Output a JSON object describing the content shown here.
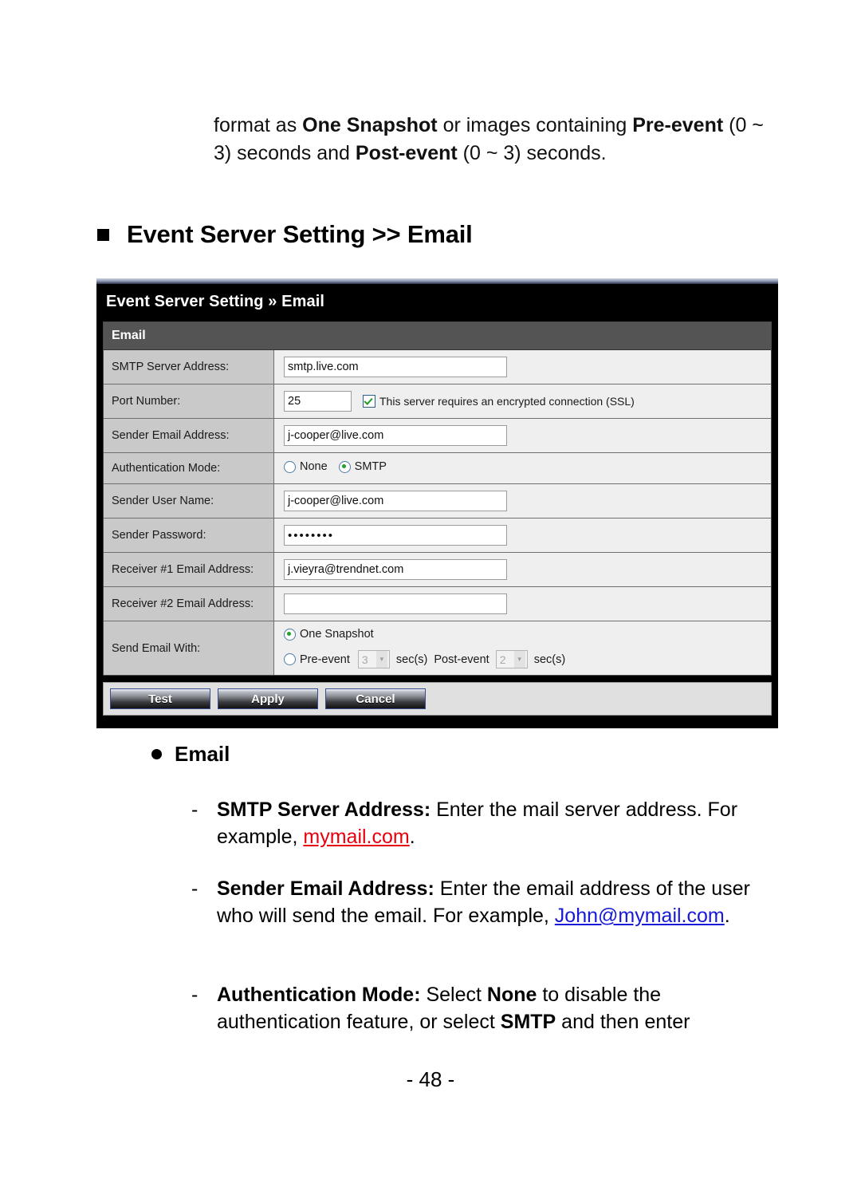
{
  "document": {
    "intro_paragraph": {
      "seg1": "format as ",
      "seg2_bold": "One Snapshot",
      "seg3": " or images containing ",
      "seg4_bold": "Pre-event",
      "seg5": " (0 ~ 3) seconds and ",
      "seg6_bold": "Post-event",
      "seg7": " (0 ~ 3) seconds."
    },
    "section_heading": "Event Server Setting >> Email",
    "page_number": "- 48 -"
  },
  "panel": {
    "title": "Event Server Setting » Email",
    "section_bar": "Email",
    "rows": [
      {
        "label": "SMTP Server Address:",
        "value": "smtp.live.com"
      },
      {
        "label": "Port Number:",
        "value": "25",
        "checkbox_label": "This server requires an encrypted connection (SSL)",
        "checkbox_checked": true
      },
      {
        "label": "Sender Email Address:",
        "value": "j-cooper@live.com"
      },
      {
        "label": "Authentication Mode:",
        "radio_none": "None",
        "radio_smtp": "SMTP",
        "selected": "SMTP"
      },
      {
        "label": "Sender User Name:",
        "value": "j-cooper@live.com"
      },
      {
        "label": "Sender Password:",
        "value": "••••••••"
      },
      {
        "label": "Receiver #1 Email Address:",
        "value": "j.vieyra@trendnet.com"
      },
      {
        "label": "Receiver #2 Email Address:",
        "value": ""
      },
      {
        "label": "Send Email With:",
        "option_one_snapshot": "One Snapshot",
        "option_pre_event": "Pre-event",
        "pre_event_value": "3",
        "sec_label_1": "sec(s)",
        "option_post_event": "Post-event",
        "post_event_value": "2",
        "sec_label_2": "sec(s)",
        "selected": "One Snapshot"
      }
    ],
    "buttons": {
      "test": "Test",
      "apply": "Apply",
      "cancel": "Cancel"
    }
  },
  "notes": {
    "heading": "Email",
    "items": [
      {
        "dash": "-",
        "term": "SMTP Server Address:",
        "text_before": " Enter the mail server address. For example, ",
        "link": "mymail.com",
        "link_color": "#e8000d",
        "text_after": "."
      },
      {
        "dash": "-",
        "term": "Sender Email Address:",
        "text_before": " Enter the email address of the user who will send the email. For example, ",
        "link": "John@mymail.com",
        "link_color": "#1818d8",
        "text_after": "."
      },
      {
        "dash": "-",
        "term": "Authentication Mode:",
        "seg_a": " Select ",
        "term_b": "None",
        "seg_b": " to disable the authentication feature, or select ",
        "term_c": "SMTP",
        "seg_c": " and then enter"
      }
    ]
  }
}
